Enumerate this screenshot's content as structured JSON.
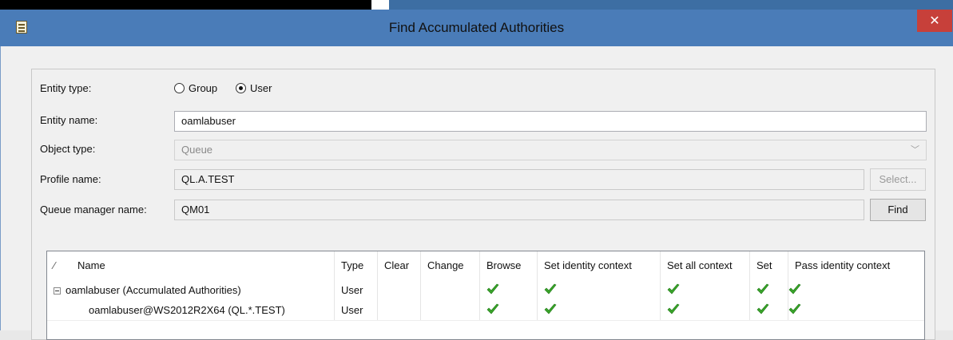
{
  "window": {
    "title": "Find Accumulated Authorities",
    "close_glyph": "✕"
  },
  "form": {
    "entity_type_label": "Entity type:",
    "entity_type_options": [
      {
        "label": "Group",
        "selected": false
      },
      {
        "label": "User",
        "selected": true
      }
    ],
    "entity_name_label": "Entity name:",
    "entity_name_value": "oamlabuser",
    "object_type_label": "Object type:",
    "object_type_value": "Queue",
    "profile_name_label": "Profile name:",
    "profile_name_value": "QL.A.TEST",
    "select_button": "Select...",
    "qmgr_label": "Queue manager name:",
    "qmgr_value": "QM01",
    "find_button": "Find"
  },
  "table": {
    "sort_glyph": "⁄",
    "columns": [
      "Name",
      "Type",
      "Clear",
      "Change",
      "Browse",
      "Set identity context",
      "Set all context",
      "Set",
      "Pass identity context"
    ],
    "rows": [
      {
        "name": "oamlabuser (Accumulated Authorities)",
        "type": "User",
        "expandable": true,
        "auth": [
          false,
          false,
          true,
          true,
          true,
          true,
          true
        ]
      },
      {
        "name": "oamlabuser@WS2012R2X64 (QL.*.TEST)",
        "type": "User",
        "expandable": false,
        "auth": [
          false,
          false,
          true,
          true,
          true,
          true,
          true
        ]
      }
    ]
  },
  "colors": {
    "titlebar": "#4a7cb8",
    "close": "#c7403a",
    "check_green": "#3aa52a"
  },
  "icons": {
    "app": "app-document-icon",
    "check": "green-checkmark-icon",
    "collapse": "tree-collapse-icon"
  }
}
